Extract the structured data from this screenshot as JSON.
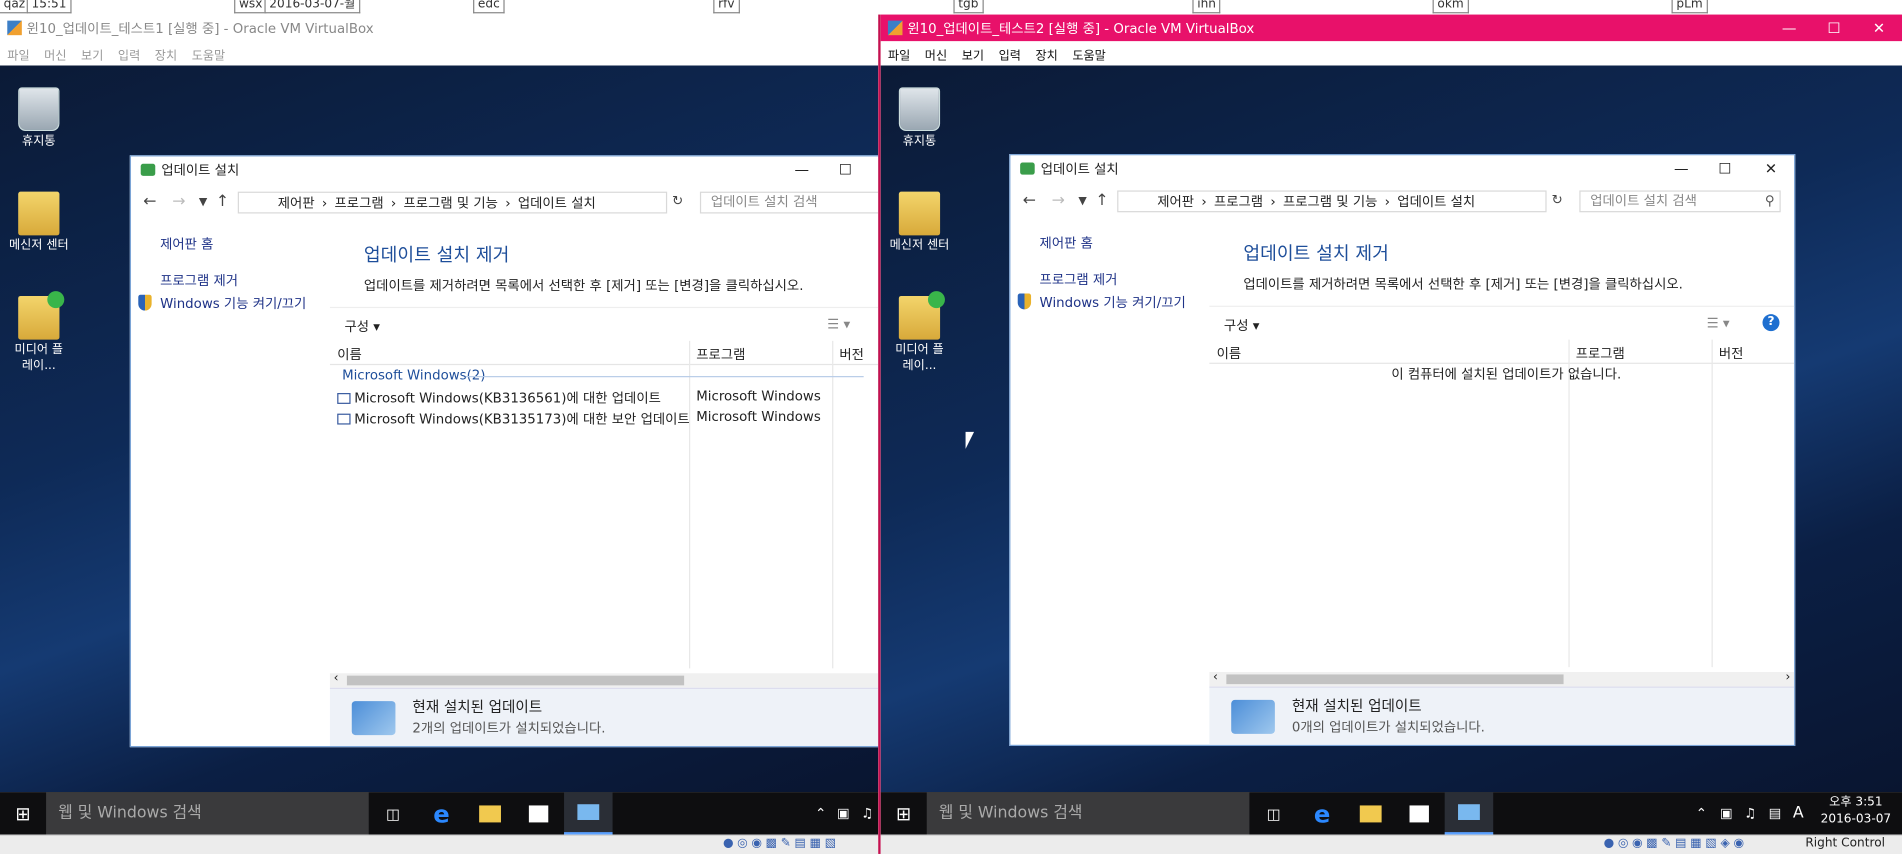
{
  "top_labels": [
    "qaz",
    "15:51",
    "wsx",
    "2016-03-07-월",
    "edc",
    "rfv",
    "tgb",
    "ihn",
    "okm",
    "pLm"
  ],
  "colors": {
    "vm1_title_bg": "#ffffff",
    "vm2_title_bg": "#e8116a",
    "vm2_border": "#c4104f",
    "accent": "#1e4e9a",
    "link": "#1e3287"
  },
  "vm1": {
    "title": "윈10_업데이트_테스트1 [실행 중] - Oracle VM VirtualBox",
    "menu": [
      "파일",
      "머신",
      "보기",
      "입력",
      "장치",
      "도움말"
    ],
    "desktop_icons": [
      "휴지통",
      "메신저 센터",
      "미디어 플레이..."
    ],
    "explorer": {
      "title": "업데이트 설치",
      "breadcrumb": [
        "제어판",
        "프로그램",
        "프로그램 및 기능",
        "업데이트 설치"
      ],
      "search_placeholder": "업데이트 설치 검색",
      "left_links": [
        "제어판 홈",
        "프로그램 제거",
        "Windows 기능 켜기/끄기"
      ],
      "heading": "업데이트 설치 제거",
      "description": "업데이트를 제거하려면 목록에서 선택한 후 [제거] 또는 [변경]을 클릭하십시오.",
      "organize": "구성",
      "columns": [
        "이름",
        "프로그램",
        "버전"
      ],
      "group": "Microsoft Windows(2)",
      "rows": [
        {
          "name": "Microsoft Windows(KB3136561)에 대한 업데이트",
          "program": "Microsoft Windows"
        },
        {
          "name": "Microsoft Windows(KB3135173)에 대한 보안 업데이트",
          "program": "Microsoft Windows"
        }
      ],
      "details_title": "현재 설치된 업데이트",
      "details_text": "2개의 업데이트가 설치되었습니다."
    },
    "taskbar": {
      "search": "웹 및 Windows 검색"
    }
  },
  "vm2": {
    "title": "윈10_업데이트_테스트2 [실행 중] - Oracle VM VirtualBox",
    "menu": [
      "파일",
      "머신",
      "보기",
      "입력",
      "장치",
      "도움말"
    ],
    "desktop_icons": [
      "휴지통",
      "메신저 센터",
      "미디어 플레이..."
    ],
    "explorer": {
      "title": "업데이트 설치",
      "breadcrumb": [
        "제어판",
        "프로그램",
        "프로그램 및 기능",
        "업데이트 설치"
      ],
      "search_placeholder": "업데이트 설치 검색",
      "left_links": [
        "제어판 홈",
        "프로그램 제거",
        "Windows 기능 켜기/끄기"
      ],
      "heading": "업데이트 설치 제거",
      "description": "업데이트를 제거하려면 목록에서 선택한 후 [제거] 또는 [변경]을 클릭하십시오.",
      "organize": "구성",
      "columns": [
        "이름",
        "프로그램",
        "버전"
      ],
      "empty": "이 컴퓨터에 설치된 업데이트가 없습니다.",
      "details_title": "현재 설치된 업데이트",
      "details_text": "0개의 업데이트가 설치되었습니다."
    },
    "taskbar": {
      "search": "웹 및 Windows 검색",
      "time": "오후 3:51",
      "date": "2016-03-07",
      "ime": "A"
    },
    "status_host_key": "Right Control"
  },
  "icons": [
    "start-icon",
    "task-view-icon",
    "edge-icon",
    "file-explorer-icon",
    "store-icon",
    "control-panel-icon",
    "back-icon",
    "forward-icon",
    "up-icon",
    "refresh-icon",
    "search-icon",
    "help-icon",
    "shield-icon",
    "update-icon"
  ]
}
